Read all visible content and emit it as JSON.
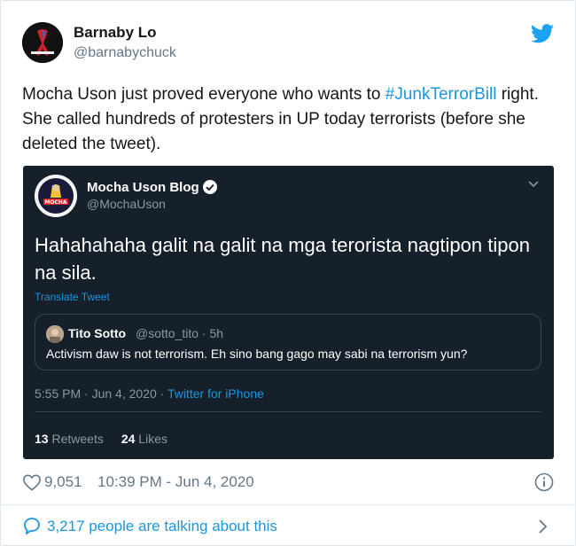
{
  "author": {
    "name": "Barnaby Lo",
    "handle": "@barnabychuck"
  },
  "tweet": {
    "text_before": "Mocha Uson just proved everyone who wants to ",
    "hashtag": "#JunkTerrorBill",
    "text_after": " right. She called hundreds of protesters in UP today terrorists (before she deleted the tweet)."
  },
  "embedded": {
    "name": "Mocha Uson Blog",
    "handle": "@MochaUson",
    "text": "Hahahahaha galit na galit na mga terorista nagtipon tipon na sila.",
    "translate": "Translate Tweet",
    "quote": {
      "name": "Tito Sotto",
      "meta": "@sotto_tito · 5h",
      "text": "Activism daw is not terrorism. Eh sino bang gago may sabi na terrorism yun?"
    },
    "time": "5:55 PM · Jun 4, 2020 · ",
    "source": "Twitter for iPhone",
    "retweets_count": "13",
    "retweets_label": "Retweets",
    "likes_count": "24",
    "likes_label": "Likes",
    "avatar_label": "MOCHA"
  },
  "footer": {
    "likes": "9,051",
    "timestamp": "10:39 PM - Jun 4, 2020",
    "talking": "3,217 people are talking about this"
  },
  "colors": {
    "accent": "#1b95e0",
    "embed_bg": "#15202b",
    "muted": "#657786"
  },
  "icons": [
    "twitter-bird-icon",
    "verified-badge-icon",
    "chevron-down-icon",
    "heart-icon",
    "info-icon",
    "reply-bubble-icon",
    "chevron-right-icon"
  ]
}
